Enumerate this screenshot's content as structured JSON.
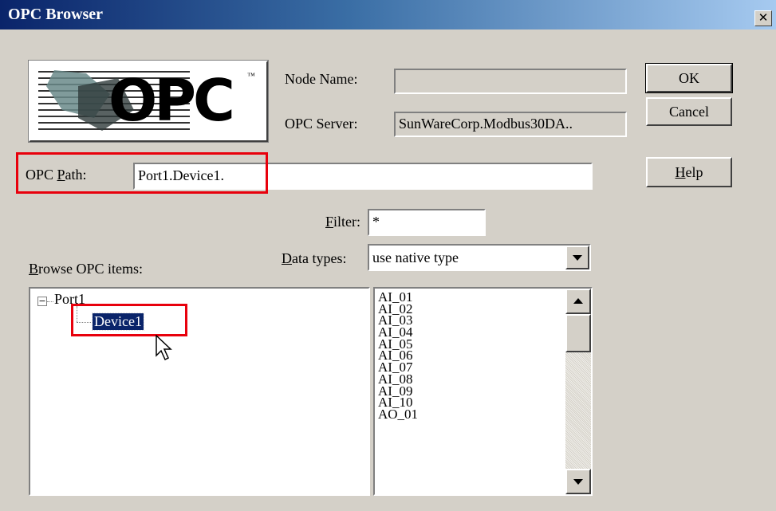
{
  "window": {
    "title": "OPC Browser",
    "close_glyph": "✕"
  },
  "logo": {
    "text": "OPC",
    "tm": "™"
  },
  "labels": {
    "node_name": "Node Name:",
    "opc_server": "OPC Server:",
    "opc_path_pre": "OPC ",
    "opc_path_u": "P",
    "opc_path_post": "ath:",
    "filter_u": "F",
    "filter_post": "ilter:",
    "data_types_u": "D",
    "data_types_post": "ata types:",
    "browse_u": "B",
    "browse_post": "rowse OPC items:"
  },
  "fields": {
    "node_name": "",
    "opc_server": "SunWareCorp.Modbus30DA..",
    "opc_path": "Port1.Device1.",
    "filter": "*",
    "data_type": "use native type"
  },
  "buttons": {
    "ok": "OK",
    "cancel": "Cancel",
    "help_u": "H",
    "help_post": "elp"
  },
  "tree": {
    "expander": "−",
    "root": "Port1",
    "child": "Device1"
  },
  "items": [
    "AI_01",
    "AI_02",
    "AI_03",
    "AI_04",
    "AI_05",
    "AI_06",
    "AI_07",
    "AI_08",
    "AI_09",
    "AI_10",
    "AO_01"
  ],
  "colors": {
    "highlight": "#e8000c",
    "selection": "#0a246a"
  }
}
